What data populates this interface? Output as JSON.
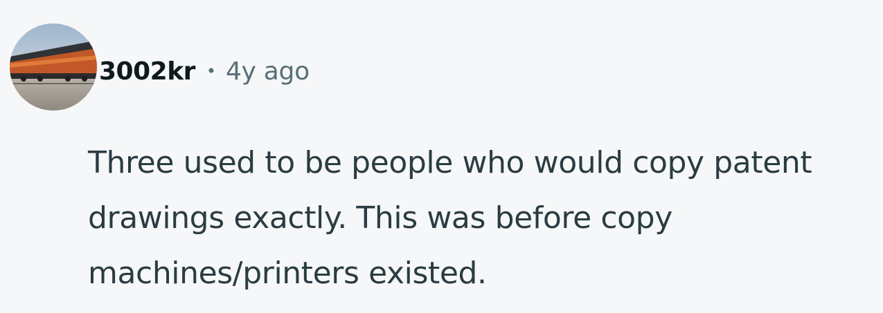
{
  "comment": {
    "author": "3002kr",
    "separator": "•",
    "timestamp": "4y ago",
    "avatar_icon": "train-locomotive-photo-avatar",
    "body": "Three used to be people who would copy patent drawings exactly. This was before copy machines/printers existed."
  },
  "colors": {
    "background": "#f6f7f8",
    "author_text": "#0f1a1c",
    "meta_text": "#576f76",
    "body_text": "#2a3c42"
  }
}
